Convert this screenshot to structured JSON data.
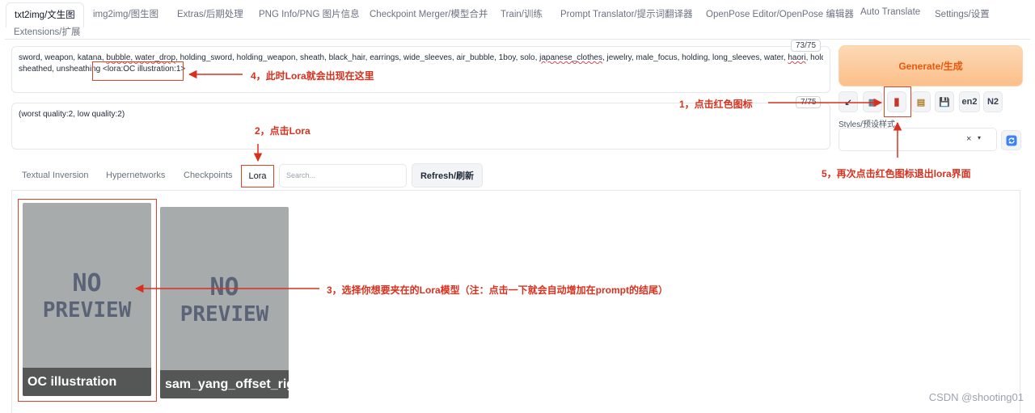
{
  "tabs": [
    {
      "label": "txt2img/文生图",
      "active": true
    },
    {
      "label": "img2img/图生图"
    },
    {
      "label": "Extras/后期处理"
    },
    {
      "label": "PNG Info/PNG 图片信息"
    },
    {
      "label": "Checkpoint Merger/模型合并"
    },
    {
      "label": "Train/训练"
    },
    {
      "label": "Prompt Translator/提示词翻译器"
    },
    {
      "label": "OpenPose Editor/OpenPose 编辑器"
    },
    {
      "label": "Auto Translate"
    },
    {
      "label": "Settings/设置"
    },
    {
      "label": "Extensions/扩展"
    }
  ],
  "prompt": {
    "counter": "73/75",
    "line1_a": "sword, weapon, katana, ",
    "line1_b": "bubble, water_drop",
    "line1_c": ", holding_sword, holding_weapon, sheath, black_hair, earrings, wide_sleeves, air_bubble, 1boy, solo, ",
    "line1_d": "japanese_clothes",
    "line1_e": ", jewelry, male_focus, holding, long_sleeves, water, ",
    "line1_f": "haori",
    "line1_g": ", holding_sheath,",
    "line2": "sheathed, unsheathing ",
    "lora_tag": "<lora:OC illustration:1>"
  },
  "negative": {
    "counter": "7/75",
    "text": "(worst quality:2, low quality:2)"
  },
  "generate_label": "Generate/生成",
  "tools": [
    "↙",
    "▦",
    "▮",
    "▤",
    "💾",
    "en2",
    "N2"
  ],
  "styles_label": "Styles/预设样式",
  "styles_clear": "×",
  "network_tabs": [
    "Textual Inversion",
    "Hypernetworks",
    "Checkpoints"
  ],
  "lora_tab": "Lora",
  "search_placeholder": "Search...",
  "refresh_label": "Refresh/刷新",
  "cards": [
    {
      "name": "OC illustration",
      "preview_text_1": "NO",
      "preview_text_2": "PREVIEW"
    },
    {
      "name": "sam_yang_offset_right_filesize",
      "preview_text_1": "NO",
      "preview_text_2": "PREVIEW"
    }
  ],
  "annotations": {
    "a1": "1，点击红色图标",
    "a2": "2，点击Lora",
    "a3": "3，选择你想要夹在的Lora模型（注：点击一下就会自动增加在prompt的结尾）",
    "a4": "4，此时Lora就会出现在这里",
    "a5": "5，再次点击红色图标退出lora界面"
  },
  "watermark": "CSDN @shooting01",
  "colors": {
    "accent_red": "#d9301e",
    "generate_text": "#ea580c",
    "generate_bg": "#fbbf8a"
  }
}
